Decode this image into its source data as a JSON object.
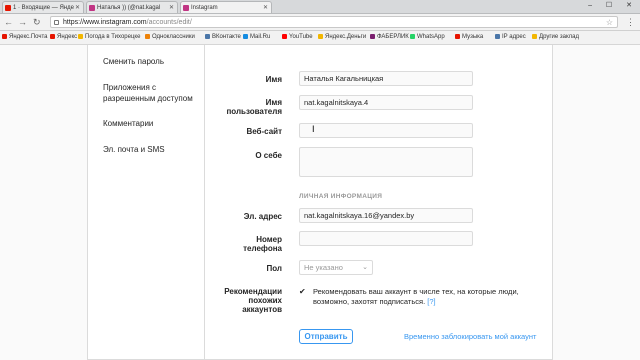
{
  "browser": {
    "tabs": [
      {
        "label": "1 · Входящие — Янде",
        "icon_color": "#e61400"
      },
      {
        "label": "Наталья )) (@nat.kagal",
        "icon_color": "#c13584"
      },
      {
        "label": "Instagram",
        "icon_color": "#c13584"
      }
    ],
    "window_controls": "– ☐ ✕",
    "url_host": "https://www.instagram.com",
    "url_path": "/accounts/edit/",
    "bookmarks": [
      {
        "label": "Яндекс.Почта",
        "color": "#e61400"
      },
      {
        "label": "Яндекс",
        "color": "#e61400"
      },
      {
        "label": "Погода в Тихорецке",
        "color": "#f2b600"
      },
      {
        "label": "Одноклассники",
        "color": "#ee8208"
      },
      {
        "label": "ВКонтакте",
        "color": "#4a76a8"
      },
      {
        "label": "Mail.Ru",
        "color": "#168de2"
      },
      {
        "label": "YouTube",
        "color": "#ff0000"
      },
      {
        "label": "Яндекс.Деньги",
        "color": "#f2b600"
      },
      {
        "label": "ФАБЕРЛИК",
        "color": "#7a1e6e"
      },
      {
        "label": "WhatsApp",
        "color": "#25d366"
      },
      {
        "label": "Музыка",
        "color": "#e61400"
      },
      {
        "label": "IP адрес",
        "color": "#4a76a8"
      },
      {
        "label": "Другие заклад",
        "color": "#f2b600"
      }
    ]
  },
  "sidebar": {
    "items": [
      {
        "label": "Сменить пароль"
      },
      {
        "label": "Приложения с разрешенным доступом"
      },
      {
        "label": "Комментарии"
      },
      {
        "label": "Эл. почта и SMS"
      }
    ]
  },
  "form": {
    "name_label": "Имя",
    "name_value": "Наталья Кагальницкая",
    "username_label": "Имя пользователя",
    "username_value": "nat.kagalnitskaya.4",
    "website_label": "Веб-сайт",
    "website_value": "",
    "bio_label": "О себе",
    "section_private": "ЛИЧНАЯ ИНФОРМАЦИЯ",
    "email_label": "Эл. адрес",
    "email_value": "nat.kagalnitskaya.16@yandex.by",
    "phone_label": "Номер телефона",
    "phone_value": "",
    "gender_label": "Пол",
    "gender_value": "Не указано",
    "recommend_label": "Рекомендации похожих аккаунтов",
    "recommend_checked": true,
    "recommend_text": "Рекомендовать ваш аккаунт в числе тех, на которые люди, возможно, захотят подписаться.",
    "recommend_help": "[?]",
    "submit_label": "Отправить",
    "disable_link": "Временно заблокировать мой аккаунт"
  }
}
